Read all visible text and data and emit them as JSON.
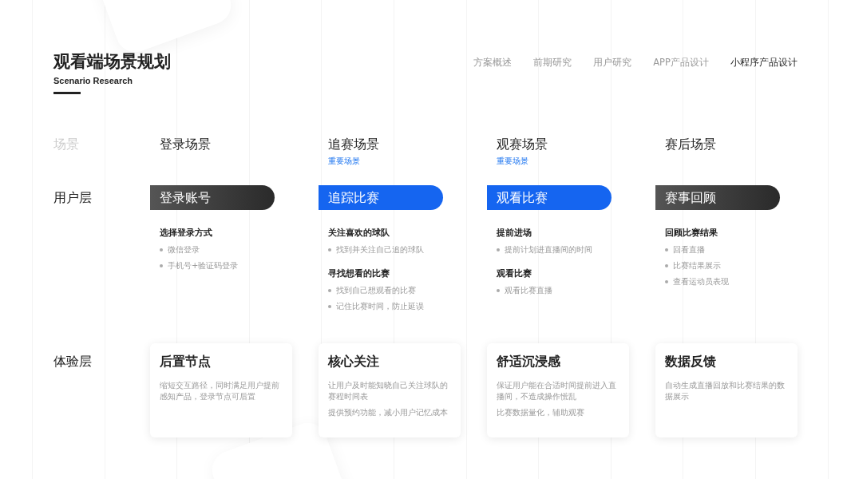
{
  "header": {
    "title": "观看端场景规划",
    "subtitle": "Scenario Research"
  },
  "nav": [
    {
      "label": "方案概述",
      "selected": false
    },
    {
      "label": "前期研究",
      "selected": false
    },
    {
      "label": "用户研究",
      "selected": false
    },
    {
      "label": "APP产品设计",
      "selected": false
    },
    {
      "label": "小程序产品设计",
      "selected": true
    }
  ],
  "row_labels": {
    "scene": "场景",
    "user_layer": "用户层",
    "experience_layer": "体验层"
  },
  "scenes": [
    {
      "name": "登录场景",
      "highlighted": false,
      "goal": "登录账号",
      "tasks": [
        {
          "heading": "选择登录方式",
          "points": [
            "微信登录",
            "手机号+验证码登录"
          ]
        }
      ],
      "experience": {
        "title": "后置节点",
        "notes": [
          "缩短交互路径，同时满足用户提前感知产品，登录节点可后置"
        ]
      }
    },
    {
      "name": "追赛场景",
      "tag": "重要场景",
      "highlighted": true,
      "goal": "追踪比赛",
      "tasks": [
        {
          "heading": "关注喜欢的球队",
          "points": [
            "找到并关注自己追的球队"
          ]
        },
        {
          "heading": "寻找想看的比赛",
          "points": [
            "找到自己想观看的比赛",
            "记住比赛时间，防止延误"
          ]
        }
      ],
      "experience": {
        "title": "核心关注",
        "notes": [
          "让用户及时能知晓自己关注球队的赛程时间表",
          "提供预约功能，减小用户记忆成本"
        ]
      }
    },
    {
      "name": "观赛场景",
      "tag": "重要场景",
      "highlighted": true,
      "goal": "观看比赛",
      "tasks": [
        {
          "heading": "提前进场",
          "points": [
            "提前计划进直播间的时间"
          ]
        },
        {
          "heading": "观看比赛",
          "points": [
            "观看比赛直播"
          ]
        }
      ],
      "experience": {
        "title": "舒适沉浸感",
        "notes": [
          "保证用户能在合适时间提前进入直播间，不造成操作慌乱",
          "比赛数据量化，辅助观赛"
        ]
      }
    },
    {
      "name": "赛后场景",
      "highlighted": false,
      "goal": "赛事回顾",
      "tasks": [
        {
          "heading": "回顾比赛结果",
          "points": [
            "回看直播",
            "比赛结果展示",
            "查看运动员表现"
          ]
        }
      ],
      "experience": {
        "title": "数据反馈",
        "notes": [
          "自动生成直播回放和比赛结果的数据展示"
        ]
      }
    }
  ]
}
